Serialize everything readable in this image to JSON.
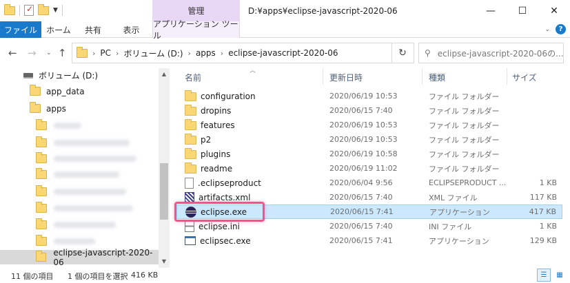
{
  "window": {
    "title": "D:¥apps¥eclipse-javascript-2020-06",
    "context_group": "管理",
    "controls": {
      "minimize": "—",
      "maximize": "☐",
      "close": "✕"
    }
  },
  "ribbon": {
    "tabs": [
      "ファイル",
      "ホーム",
      "共有",
      "表示",
      "アプリケーション ツール"
    ]
  },
  "address": {
    "crumbs": [
      "PC",
      "ボリューム (D:)",
      "apps",
      "eclipse-javascript-2020-06"
    ],
    "search_placeholder": "eclipse-javascript-2020-06の..."
  },
  "sidebar": {
    "items": [
      {
        "label": "ボリューム (D:)",
        "icon": "drive-icon"
      },
      {
        "label": "app_data",
        "icon": "folder-icon"
      },
      {
        "label": "apps",
        "icon": "folder-icon"
      },
      {
        "label": "",
        "icon": "folder-icon",
        "redacted": true
      },
      {
        "label": "",
        "icon": "folder-icon",
        "redacted": true
      },
      {
        "label": "",
        "icon": "folder-icon",
        "redacted": true
      },
      {
        "label": "",
        "icon": "folder-icon",
        "redacted": true
      },
      {
        "label": "",
        "icon": "folder-icon",
        "redacted": true
      },
      {
        "label": "",
        "icon": "folder-icon",
        "redacted": true
      },
      {
        "label": "",
        "icon": "folder-icon",
        "redacted": true
      },
      {
        "label": "",
        "icon": "folder-icon",
        "redacted": true
      },
      {
        "label": "eclipse-javascript-2020-06",
        "icon": "folder-icon",
        "selected": true
      }
    ]
  },
  "columns": {
    "name": "名前",
    "date": "更新日時",
    "type": "種類",
    "size": "サイズ"
  },
  "files": [
    {
      "name": "configuration",
      "date": "2020/06/19 10:53",
      "type": "ファイル フォルダー",
      "size": "",
      "icon": "folder"
    },
    {
      "name": "dropins",
      "date": "2020/06/15 7:40",
      "type": "ファイル フォルダー",
      "size": "",
      "icon": "folder"
    },
    {
      "name": "features",
      "date": "2020/06/19 10:53",
      "type": "ファイル フォルダー",
      "size": "",
      "icon": "folder"
    },
    {
      "name": "p2",
      "date": "2020/06/19 10:53",
      "type": "ファイル フォルダー",
      "size": "",
      "icon": "folder"
    },
    {
      "name": "plugins",
      "date": "2020/06/19 10:58",
      "type": "ファイル フォルダー",
      "size": "",
      "icon": "folder"
    },
    {
      "name": "readme",
      "date": "2020/06/19 11:02",
      "type": "ファイル フォルダー",
      "size": "",
      "icon": "folder"
    },
    {
      "name": ".eclipseproduct",
      "date": "2020/06/04 9:56",
      "type": "ECLIPSEPRODUCT ...",
      "size": "1 KB",
      "icon": "file"
    },
    {
      "name": "artifacts.xml",
      "date": "2020/06/15 7:40",
      "type": "XML ファイル",
      "size": "117 KB",
      "icon": "xml"
    },
    {
      "name": "eclipse.exe",
      "date": "2020/06/15 7:41",
      "type": "アプリケーション",
      "size": "417 KB",
      "icon": "eclipse",
      "selected": true
    },
    {
      "name": "eclipse.ini",
      "date": "2020/06/15 7:40",
      "type": "INI ファイル",
      "size": "1 KB",
      "icon": "ini"
    },
    {
      "name": "eclipsec.exe",
      "date": "2020/06/15 7:41",
      "type": "アプリケーション",
      "size": "129 KB",
      "icon": "exe"
    }
  ],
  "status": {
    "count": "11 個の項目",
    "selection": "1 個の項目を選択",
    "selection_size": "416 KB"
  },
  "colors": {
    "accent": "#1979ca",
    "context_tab": "#e8d8f6",
    "selected_row": "#cce8ff",
    "highlight": "#ff4f8b"
  }
}
